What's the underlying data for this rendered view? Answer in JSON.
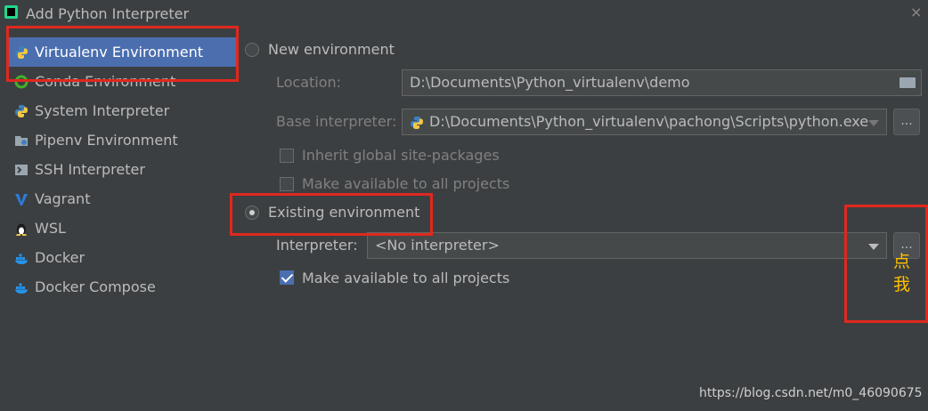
{
  "window": {
    "title": "Add Python Interpreter",
    "close_glyph": "×"
  },
  "sidebar": {
    "items": [
      {
        "label": "Virtualenv Environment",
        "icon": "python-icon",
        "selected": true
      },
      {
        "label": "Conda Environment",
        "icon": "conda-icon",
        "selected": false
      },
      {
        "label": "System Interpreter",
        "icon": "python-icon",
        "selected": false
      },
      {
        "label": "Pipenv Environment",
        "icon": "pipenv-icon",
        "selected": false
      },
      {
        "label": "SSH Interpreter",
        "icon": "ssh-icon",
        "selected": false
      },
      {
        "label": "Vagrant",
        "icon": "vagrant-icon",
        "selected": false
      },
      {
        "label": "WSL",
        "icon": "linux-penguin-icon",
        "selected": false
      },
      {
        "label": "Docker",
        "icon": "docker-icon",
        "selected": false
      },
      {
        "label": "Docker Compose",
        "icon": "docker-icon",
        "selected": false
      }
    ]
  },
  "new_env": {
    "radio_label": "New environment",
    "selected": false,
    "location_label": "Location:",
    "location_value": "D:\\Documents\\Python_virtualenv\\demo",
    "base_label": "Base interpreter:",
    "base_value": "D:\\Documents\\Python_virtualenv\\pachong\\Scripts\\python.exe",
    "browse_label": "...",
    "inherit_label": "Inherit global site-packages",
    "make_available_label": "Make available to all projects"
  },
  "existing_env": {
    "radio_label": "Existing environment",
    "selected": true,
    "interpreter_label": "Interpreter:",
    "interpreter_value": "<No interpreter>",
    "browse_label": "...",
    "make_available_label": "Make available to all projects",
    "make_available_checked": true
  },
  "annotation": {
    "text_line1": "点",
    "text_line2": "我",
    "color": "#ffc000",
    "box_color": "#e0281e"
  },
  "watermark": "https://blog.csdn.net/m0_46090675",
  "colors": {
    "background": "#3c3f41",
    "selection": "#4b6eaf",
    "text": "#bbbbbb",
    "disabled_text": "#808080"
  }
}
